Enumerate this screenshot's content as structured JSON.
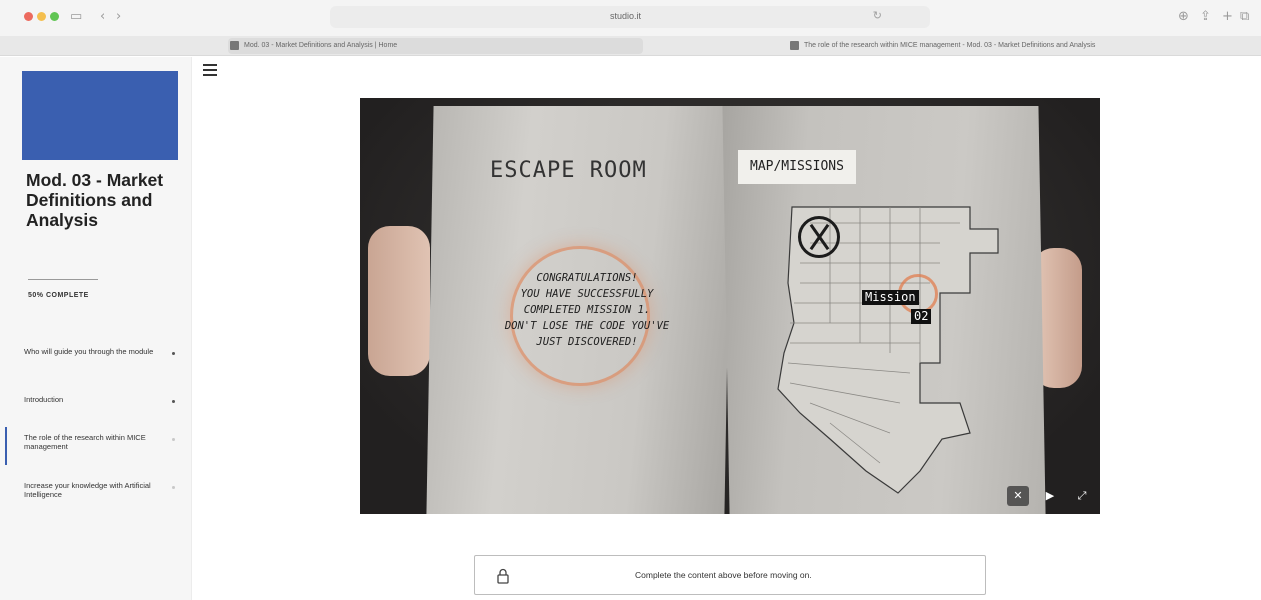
{
  "browser": {
    "url": "studio.it",
    "tabs": [
      {
        "title": "Mod. 03 - Market Definitions and Analysis | Home"
      },
      {
        "title": "The role of the research within MICE management - Mod. 03 - Market Definitions and Analysis"
      }
    ]
  },
  "sidebar": {
    "course_title": "Mod. 03 - Market Definitions and Analysis",
    "progress_text": "50% COMPLETE",
    "lessons": [
      {
        "label": "Who will guide you through the module",
        "status": "complete"
      },
      {
        "label": "Introduction",
        "status": "complete"
      },
      {
        "label": "The role of the research within MICE management",
        "status": "current"
      },
      {
        "label": "Increase your knowledge with Artificial Intelligence",
        "status": "pending"
      }
    ]
  },
  "media": {
    "left_title": "ESCAPE ROOM",
    "message_lines": [
      "CONGRATULATIONS!",
      "YOU HAVE SUCCESSFULLY",
      "COMPLETED MISSION 1.",
      "DON'T LOSE THE CODE YOU'VE",
      "JUST DISCOVERED!"
    ],
    "right_title": "MAP/MISSIONS",
    "mission_label": "Mission",
    "mission_number": "02"
  },
  "notice": {
    "text": "Complete the content above before moving on."
  },
  "colors": {
    "accent": "#3a5fb0",
    "mission_ring": "#e1784a"
  }
}
